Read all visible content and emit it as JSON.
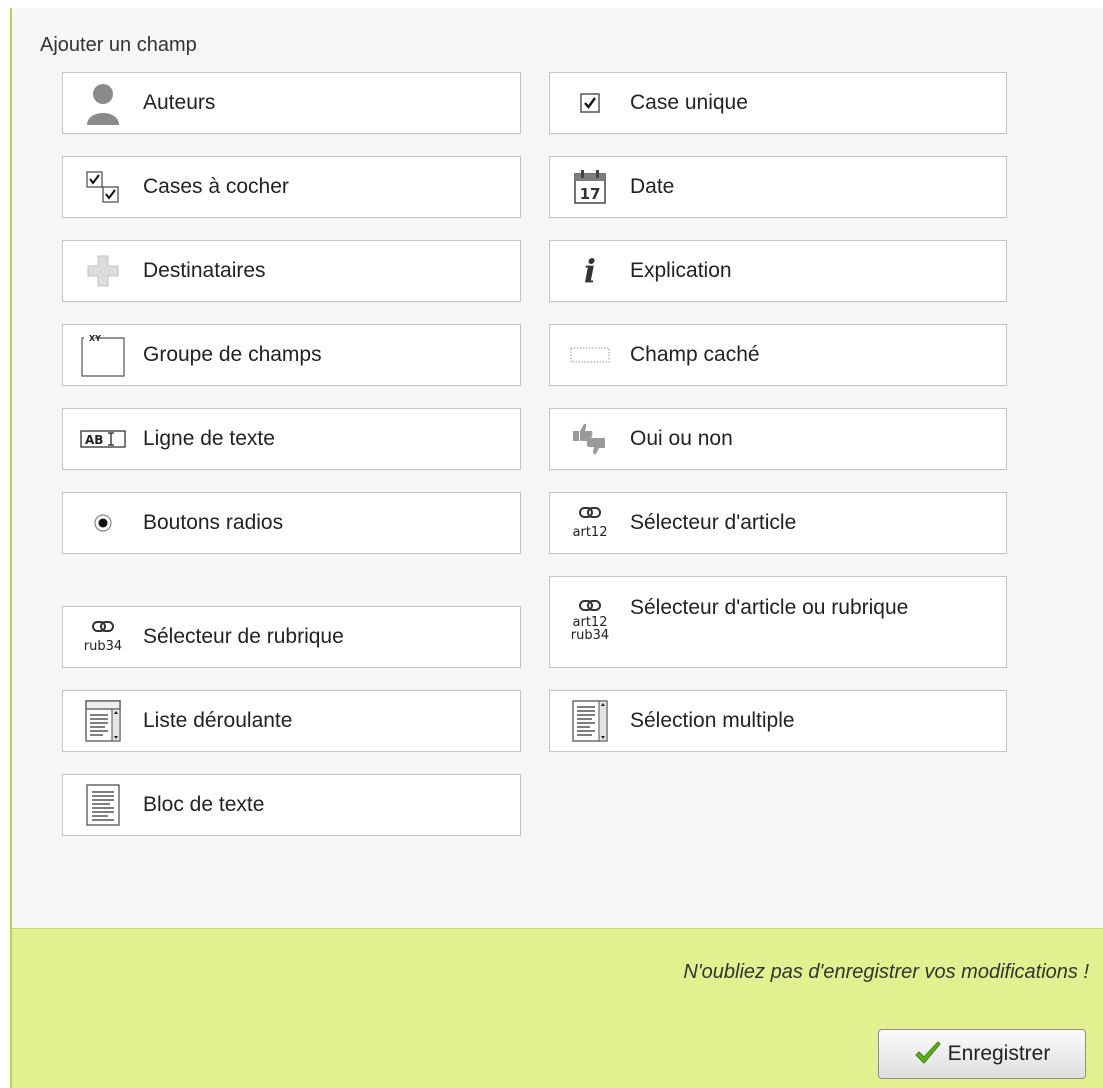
{
  "panel": {
    "title": "Ajouter un champ"
  },
  "fields": [
    {
      "icon": "user-icon",
      "label": "Auteurs"
    },
    {
      "icon": "checkbox-icon",
      "label": "Case unique"
    },
    {
      "icon": "checkboxes-icon",
      "label": "Cases à cocher"
    },
    {
      "icon": "calendar-icon",
      "label": "Date",
      "icon_text": "17"
    },
    {
      "icon": "plus-icon",
      "label": "Destinataires"
    },
    {
      "icon": "info-icon",
      "label": "Explication",
      "icon_text": "i"
    },
    {
      "icon": "fieldset-icon",
      "label": "Groupe de champs",
      "icon_text": "XY"
    },
    {
      "icon": "hidden-field-icon",
      "label": "Champ caché"
    },
    {
      "icon": "text-line-icon",
      "label": "Ligne de texte",
      "icon_text": "AB"
    },
    {
      "icon": "thumbs-icon",
      "label": "Oui ou non"
    },
    {
      "icon": "radio-icon",
      "label": "Boutons radios"
    },
    {
      "icon": "article-link-icon",
      "label": "Sélecteur d'article",
      "icon_text": "art12"
    },
    {
      "icon": "rubric-link-icon",
      "label": "Sélecteur de rubrique",
      "icon_text": "rub34"
    },
    {
      "icon": "article-rubric-link-icon",
      "label": "Sélecteur d'article ou rubrique",
      "icon_text": "art12",
      "icon_text2": "rub34"
    },
    {
      "icon": "dropdown-list-icon",
      "label": "Liste déroulante"
    },
    {
      "icon": "multi-select-icon",
      "label": "Sélection multiple"
    },
    {
      "icon": "text-block-icon",
      "label": "Bloc de texte"
    }
  ],
  "footer": {
    "reminder": "N'oubliez pas d'enregistrer vos modifications !",
    "save_label": "Enregistrer",
    "save_icon": "checkmark-icon"
  }
}
